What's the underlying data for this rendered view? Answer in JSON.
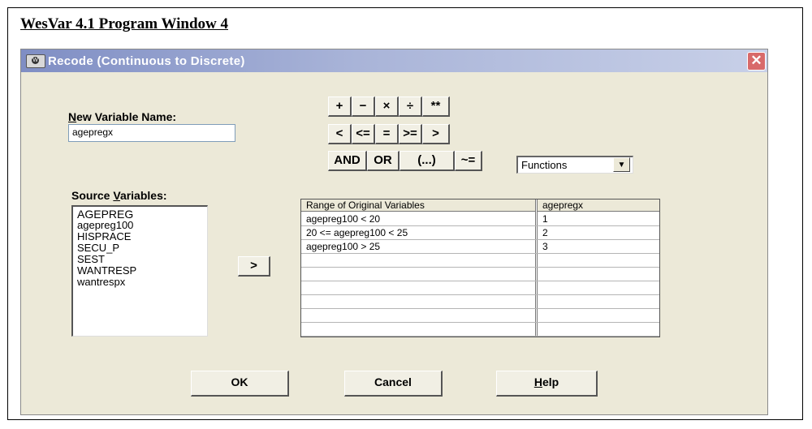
{
  "doc_title": "WesVar 4.1 Program Window 4",
  "window": {
    "title": "Recode (Continuous to Discrete)",
    "close_label": "✕"
  },
  "new_variable": {
    "label_mnemonic": "N",
    "label_rest": "ew Variable Name:",
    "value": "agepregx"
  },
  "operators": {
    "row1": [
      "+",
      "−",
      "×",
      "÷",
      "**"
    ],
    "row2": [
      "<",
      "<=",
      "=",
      ">=",
      ">"
    ],
    "row3": [
      "AND",
      "OR",
      "(...)",
      "~="
    ]
  },
  "functions_dropdown": {
    "value": "Functions",
    "arrow_icon": "chevron-down-icon"
  },
  "source_variables": {
    "label_start": "Source ",
    "label_mnemonic": "V",
    "label_rest": "ariables:",
    "items": [
      "AGEPREG",
      "agepreg100",
      "HISPRACE",
      "SECU_P",
      "SEST",
      "WANTRESP",
      "wantrespx"
    ]
  },
  "move_button_label": ">",
  "recode_table": {
    "headers": [
      "Range of Original Variables",
      "agepregx"
    ],
    "rows": [
      [
        "agepreg100 < 20",
        "1"
      ],
      [
        "20 <= agepreg100 < 25",
        "2"
      ],
      [
        "agepreg100 > 25",
        "3"
      ]
    ]
  },
  "buttons": {
    "ok": "OK",
    "cancel": "Cancel",
    "help_mnemonic": "H",
    "help_rest": "elp"
  }
}
